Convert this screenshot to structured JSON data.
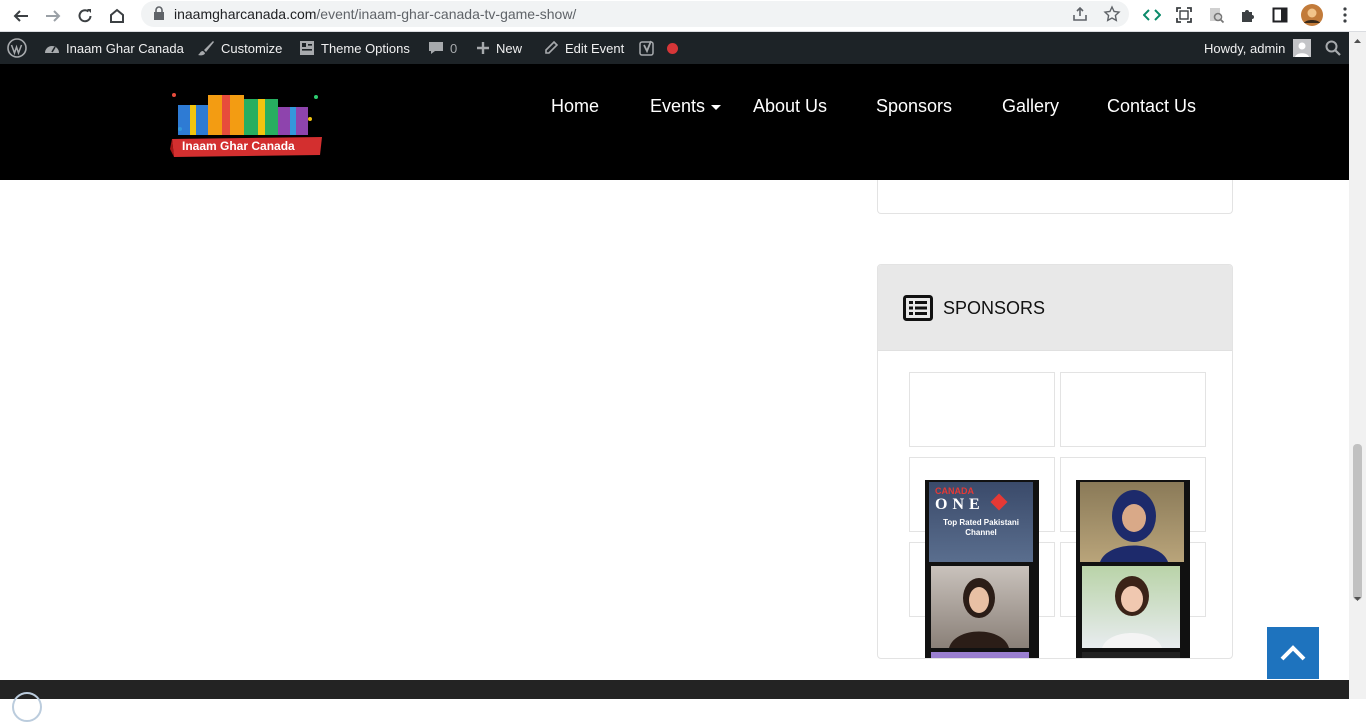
{
  "browser": {
    "url_domain": "inaamgharcanada.com",
    "url_path": "/event/inaam-ghar-canada-tv-game-show/"
  },
  "adminbar": {
    "site_name": "Inaam Ghar Canada",
    "customize": "Customize",
    "theme_options": "Theme Options",
    "comments_count": "0",
    "new": "New",
    "edit_event": "Edit Event",
    "howdy": "Howdy, admin"
  },
  "header": {
    "logo_text": "Inaam Ghar Canada",
    "menu": {
      "home": "Home",
      "events": "Events",
      "about": "About Us",
      "sponsors": "Sponsors",
      "gallery": "Gallery",
      "contact": "Contact Us"
    }
  },
  "sponsors_widget": {
    "title": "SPONSORS",
    "poster_top": "CANADA",
    "poster_brand": "ONE",
    "poster_tagline": "Top Rated Pakistani Channel"
  },
  "colors": {
    "accent": "#1e73be",
    "admin_bar": "#1d2327",
    "header_bg": "#000000",
    "status_red": "#d63638"
  }
}
